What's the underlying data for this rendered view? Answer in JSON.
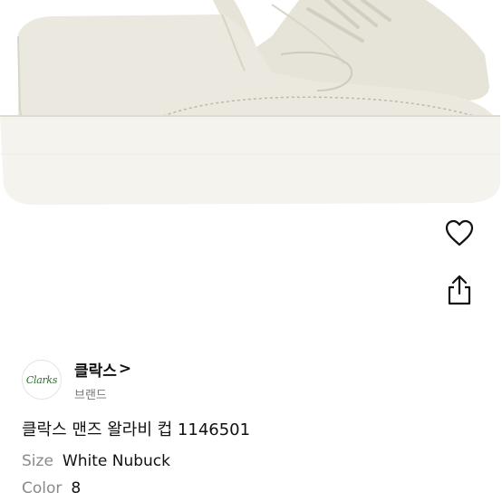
{
  "actions": {
    "like_icon": "heart-outline-icon",
    "share_icon": "share-upload-icon"
  },
  "brand": {
    "logo_text": "Clarks",
    "name": "클락스",
    "chevron": ">",
    "subtitle": "브랜드"
  },
  "product": {
    "title": "클락스 맨즈 왈라비 컵 1146501",
    "specs": [
      {
        "label": "Size",
        "value": "White Nubuck"
      },
      {
        "label": "Color",
        "value": "8"
      }
    ]
  },
  "colors": {
    "shoe_upper": "#e9e6dc",
    "shoe_sole": "#f4f3ef",
    "text_primary": "#111111",
    "text_muted": "#8a8a8a"
  }
}
